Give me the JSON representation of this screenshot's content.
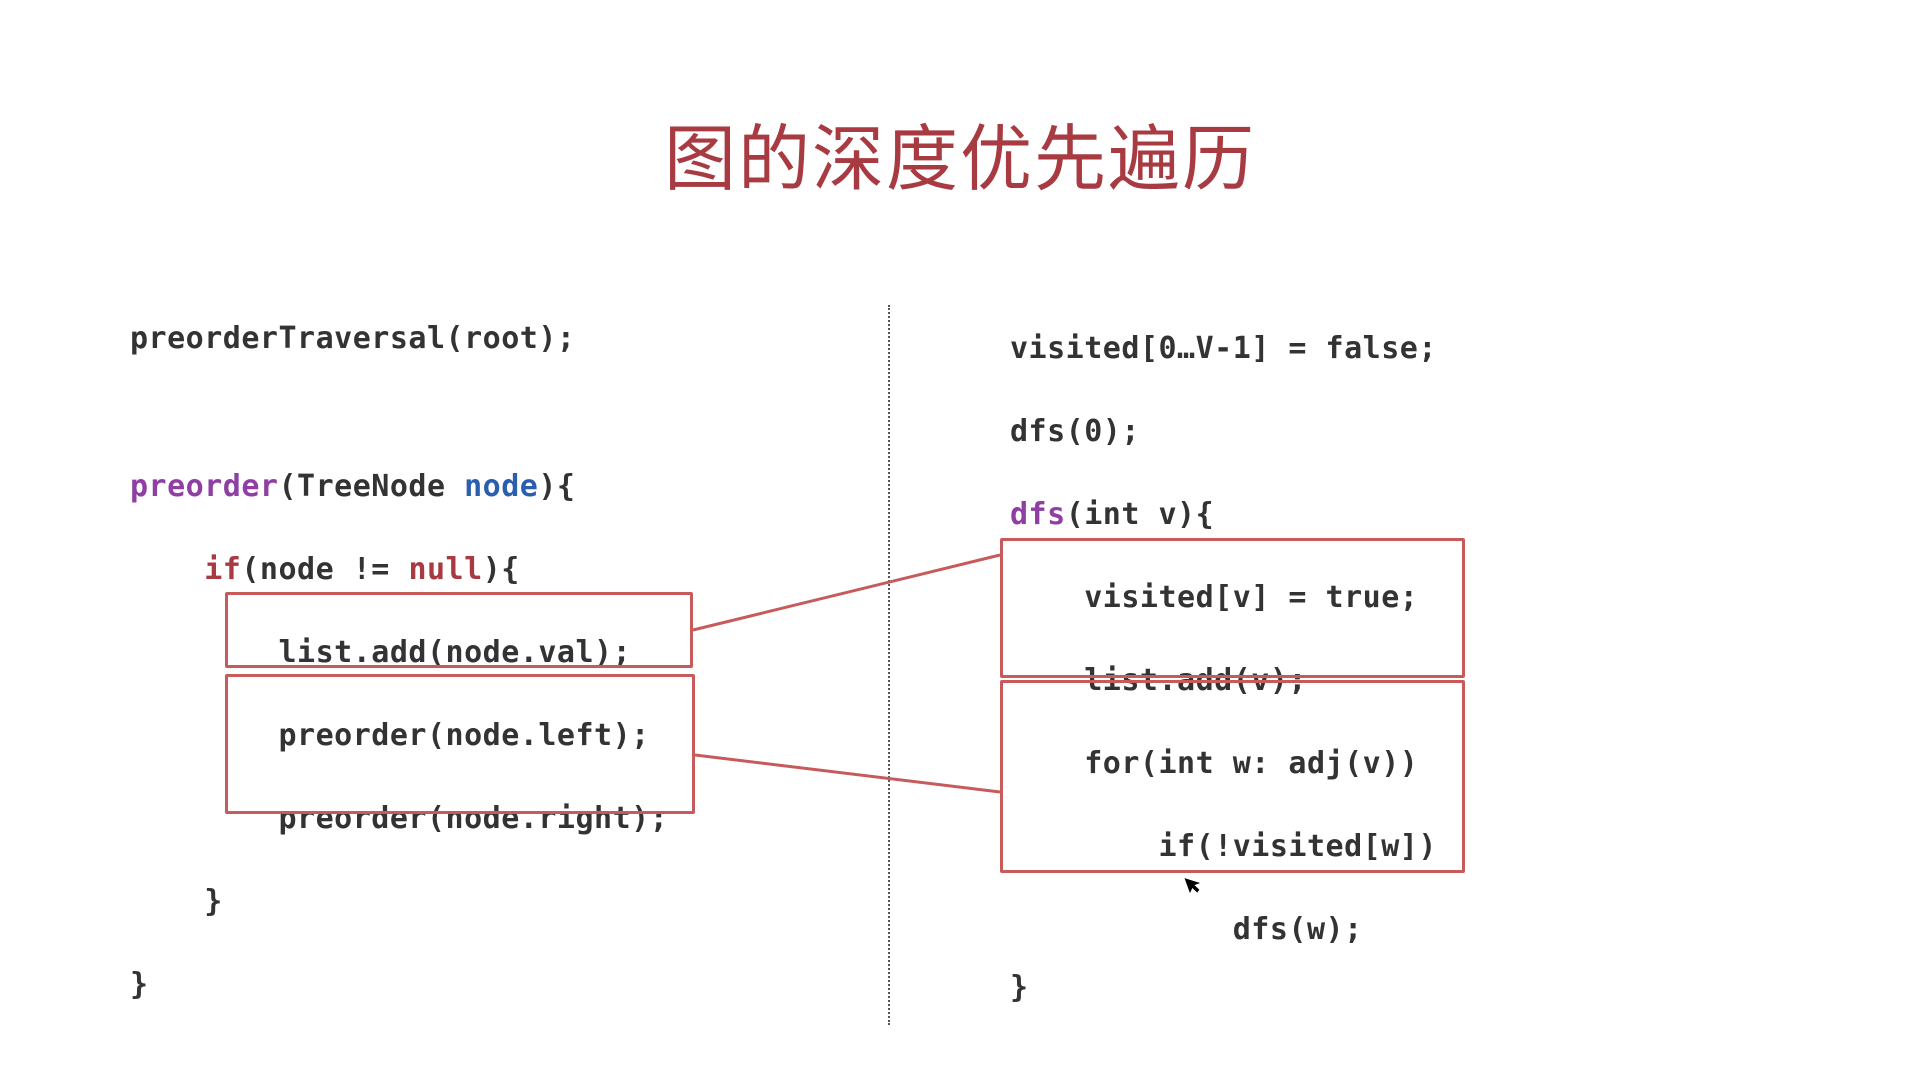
{
  "title": "图的深度优先遍历",
  "left": {
    "call": "preorderTraversal(root);",
    "sig_preorder": "preorder",
    "sig_params": "(TreeNode ",
    "sig_node": "node",
    "sig_close": "){",
    "if_kw": "if",
    "if_cond_open": "(node != ",
    "null_kw": "null",
    "if_cond_close": "){",
    "list_add": "list.add(node.val);",
    "preorder_left": "preorder(node.left);",
    "preorder_right": "preorder(node.right);",
    "close1": "}",
    "close2": "}"
  },
  "right": {
    "visited_init": "visited[0…V-1] = false;",
    "dfs_call": "dfs(0);",
    "dfs_kw": "dfs",
    "dfs_sig": "(int v){",
    "visited_true": "visited[v] = true;",
    "list_add_v": "list.add(v);",
    "for_loop": "for(int w: adj(v))",
    "if_not_visited": "if(!visited[w])",
    "dfs_w": "dfs(w);",
    "close": "}"
  },
  "colors": {
    "title": "#a83a42",
    "highlight_border": "#c75a5a",
    "keyword_purple": "#8f3ea3",
    "keyword_darkred": "#a83a42",
    "keyword_blue": "#2a5fb0"
  }
}
